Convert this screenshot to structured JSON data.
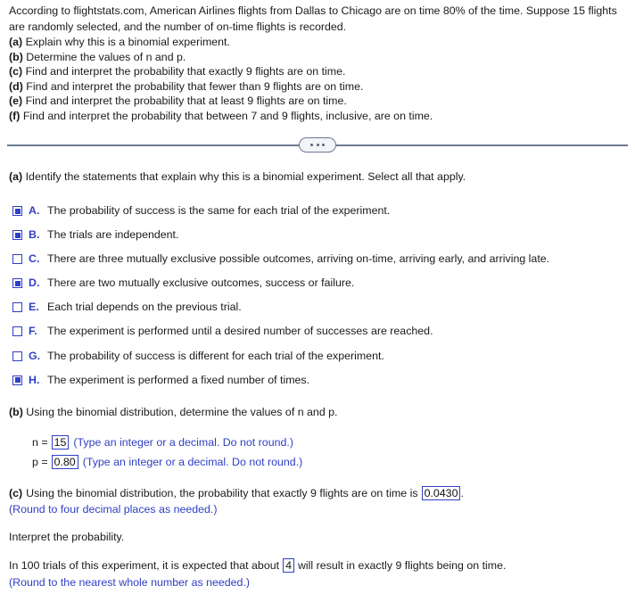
{
  "problem": {
    "stem": "According to flightstats.com, American Airlines flights from Dallas to Chicago are on time 80% of the time. Suppose 15 flights are randomly selected, and the number of on-time flights is recorded.",
    "parts": [
      {
        "label": "(a)",
        "text": "Explain why this is a binomial experiment."
      },
      {
        "label": "(b)",
        "text": "Determine the values of n and p."
      },
      {
        "label": "(c)",
        "text": "Find and interpret the probability that exactly 9 flights are on time."
      },
      {
        "label": "(d)",
        "text": "Find and interpret the probability that fewer than 9 flights are on time."
      },
      {
        "label": "(e)",
        "text": "Find and interpret the probability that at least 9 flights are on time."
      },
      {
        "label": "(f)",
        "text": "Find and interpret the probability that between 7 and 9 flights, inclusive, are on time."
      }
    ]
  },
  "divider": {
    "icon": "ellipsis-icon"
  },
  "part_a": {
    "label": "(a)",
    "prompt": "Identify the statements that explain why this is a binomial experiment. Select all that apply.",
    "choices": [
      {
        "letter": "A.",
        "text": "The probability of success is the same for each trial of the experiment.",
        "checked": true
      },
      {
        "letter": "B.",
        "text": "The trials are independent.",
        "checked": true
      },
      {
        "letter": "C.",
        "text": "There are three mutually exclusive possible outcomes, arriving on-time, arriving early, and arriving late.",
        "checked": false
      },
      {
        "letter": "D.",
        "text": "There are two mutually exclusive outcomes, success or failure.",
        "checked": true
      },
      {
        "letter": "E.",
        "text": "Each trial depends on the previous trial.",
        "checked": false
      },
      {
        "letter": "F.",
        "text": "The experiment is performed until a desired number of successes are reached.",
        "checked": false
      },
      {
        "letter": "G.",
        "text": "The probability of success is different for each trial of the experiment.",
        "checked": false
      },
      {
        "letter": "H.",
        "text": "The experiment is performed a fixed number of times.",
        "checked": true
      }
    ]
  },
  "part_b": {
    "label": "(b)",
    "prompt": "Using the binomial distribution, determine the values of n and p.",
    "n_label": "n =",
    "n_value": "15",
    "n_hint": "(Type an integer or a decimal. Do not round.)",
    "p_label": "p =",
    "p_value": "0.80",
    "p_hint": "(Type an integer or a decimal. Do not round.)"
  },
  "part_c": {
    "label": "(c)",
    "text_before": "Using the binomial distribution, the probability that exactly 9 flights are on time is",
    "value": "0.0430",
    "text_after": ".",
    "round_hint": "(Round to four decimal places as needed.)",
    "interpret_heading": "Interpret the probability.",
    "interpret_before": "In 100 trials of this experiment, it is expected that about",
    "interpret_value": "4",
    "interpret_after": "will result in exactly 9 flights being on time.",
    "interpret_round_hint": "(Round to the nearest whole number as needed.)"
  },
  "colors": {
    "accent_blue": "#2f3fc4",
    "divider_gray": "#6b7a90",
    "text": "#1a1a1a"
  }
}
